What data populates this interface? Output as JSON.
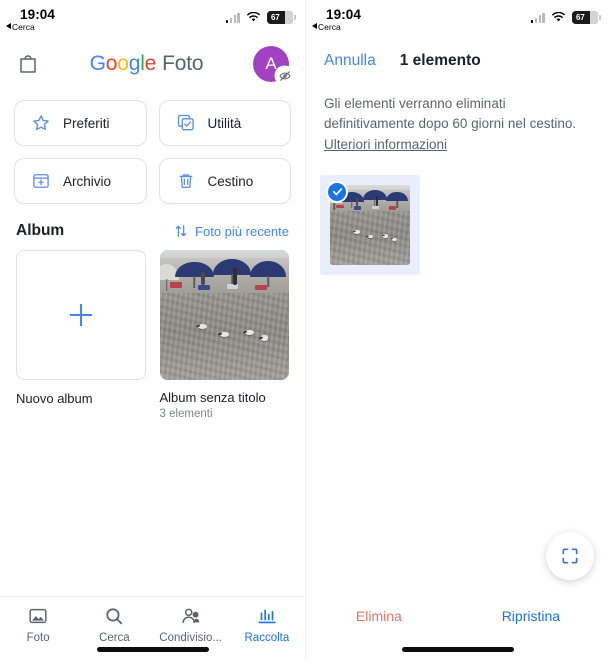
{
  "status_bar": {
    "time": "19:04",
    "back_label": "Cerca",
    "battery_percent": "67",
    "signal_icon": "cellular-bars-icon",
    "wifi_icon": "wifi-icon",
    "battery_icon": "battery-icon"
  },
  "left_screen": {
    "header": {
      "store_icon": "shopping-bag-icon",
      "logo_g": "G",
      "logo_o1": "o",
      "logo_o2": "o",
      "logo_g2": "g",
      "logo_l": "l",
      "logo_e": "e",
      "logo_product": "Foto",
      "avatar_letter": "A",
      "avatar_color": "#A142C4",
      "avatar_badge_icon": "eye-off-icon"
    },
    "quick_actions": [
      {
        "label": "Preferiti",
        "icon": "star-icon"
      },
      {
        "label": "Utilità",
        "icon": "utilities-checkbox-icon"
      },
      {
        "label": "Archivio",
        "icon": "archive-box-icon"
      },
      {
        "label": "Cestino",
        "icon": "trash-icon"
      }
    ],
    "album_section": {
      "title": "Album",
      "sort_label": "Foto più recente",
      "sort_icon": "sort-arrows-icon"
    },
    "albums": [
      {
        "label": "Nuovo album",
        "subtitle": "",
        "thumb": "plus-placeholder",
        "add_icon": "plus-icon"
      },
      {
        "label": "Album senza titolo",
        "subtitle": "3 elementi",
        "thumb": "beach-photo"
      }
    ],
    "bottom_nav": [
      {
        "label": "Foto",
        "icon": "photo-icon",
        "active": false
      },
      {
        "label": "Cerca",
        "icon": "search-icon",
        "active": false
      },
      {
        "label": "Condivisio...",
        "icon": "people-icon",
        "active": false
      },
      {
        "label": "Raccolta",
        "icon": "library-icon",
        "active": true
      }
    ]
  },
  "right_screen": {
    "header": {
      "cancel_label": "Annulla",
      "count_label": "1 elemento"
    },
    "notice": {
      "text": "Gli elementi verranno eliminati definitivamente dopo 60 giorni nel cestino. ",
      "link_label": "Ulteriori informazioni"
    },
    "selected_item": {
      "thumb": "beach-photo",
      "check_icon": "check-circle-icon",
      "selected": true
    },
    "fab": {
      "icon": "lens-frame-icon"
    },
    "actions": [
      {
        "label": "Elimina",
        "color": "#E8746B",
        "name": "delete-button"
      },
      {
        "label": "Ripristina",
        "color": "#1a73e8",
        "name": "restore-button"
      }
    ]
  },
  "colors": {
    "google_blue": "#4285F4",
    "google_red": "#EA4335",
    "google_yellow": "#FBBC05",
    "google_green": "#34A853",
    "accent_blue": "#1a73e8",
    "delete_red": "#E8746B",
    "selection_bg": "#e8eefc"
  }
}
